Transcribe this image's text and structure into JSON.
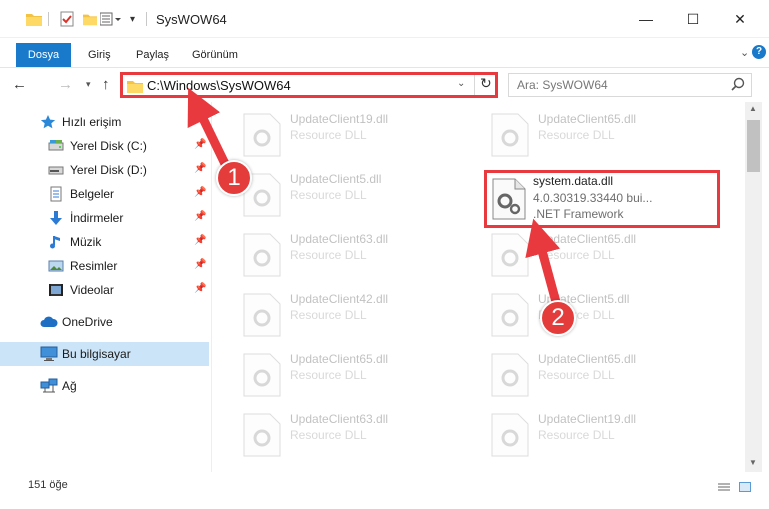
{
  "window": {
    "title": "SysWOW64",
    "minimize_glyph": "—",
    "maximize_glyph": "☐",
    "close_glyph": "✕"
  },
  "ribbon": {
    "tabs": [
      "Dosya",
      "Giriş",
      "Paylaş",
      "Görünüm"
    ]
  },
  "address_bar": {
    "path": "C:\\Windows\\SysWOW64"
  },
  "search": {
    "placeholder": "Ara: SysWOW64"
  },
  "sidebar": {
    "items": [
      {
        "label": "Hızlı erişim",
        "icon": "star-icon",
        "pinned": false
      },
      {
        "label": "Yerel Disk (C:)",
        "icon": "drive-icon",
        "pinned": true
      },
      {
        "label": "Yerel Disk (D:)",
        "icon": "drive-icon",
        "pinned": true
      },
      {
        "label": "Belgeler",
        "icon": "documents-icon",
        "pinned": true
      },
      {
        "label": "İndirmeler",
        "icon": "download-icon",
        "pinned": true
      },
      {
        "label": "Müzik",
        "icon": "music-icon",
        "pinned": true
      },
      {
        "label": "Resimler",
        "icon": "pictures-icon",
        "pinned": true
      },
      {
        "label": "Videolar",
        "icon": "videos-icon",
        "pinned": true
      },
      {
        "label": "OneDrive",
        "icon": "cloud-icon",
        "pinned": false
      },
      {
        "label": "Bu bilgisayar",
        "icon": "computer-icon",
        "pinned": false,
        "selected": true
      },
      {
        "label": "Ağ",
        "icon": "network-icon",
        "pinned": false
      }
    ]
  },
  "files": {
    "left_column": [
      {
        "name": "UpdateClient19.dll",
        "type": "Resource DLL"
      },
      {
        "name": "UpdateClient5.dll",
        "type": "Resource DLL"
      },
      {
        "name": "UpdateClient63.dll",
        "type": "Resource DLL"
      },
      {
        "name": "UpdateClient42.dll",
        "type": "Resource DLL"
      },
      {
        "name": "UpdateClient65.dll",
        "type": "Resource DLL"
      },
      {
        "name": "UpdateClient63.dll",
        "type": "Resource DLL"
      }
    ],
    "right_column": [
      {
        "name": "UpdateClient65.dll",
        "type": "Resource DLL"
      },
      {
        "name": "UpdateClient65.dll",
        "type": "Resource DLL"
      },
      {
        "name": "UpdateClient5.dll",
        "type": "Resource DLL"
      },
      {
        "name": "UpdateClient65.dll",
        "type": "Resource DLL"
      },
      {
        "name": "UpdateClient19.dll",
        "type": "Resource DLL"
      }
    ],
    "highlighted": {
      "name": "system.data.dll",
      "version": "4.0.30319.33440 bui...",
      "type": ".NET Framework"
    }
  },
  "callouts": [
    "1",
    "2"
  ],
  "status": {
    "item_count": "151 öğe"
  },
  "colors": {
    "accent": "#1979ca",
    "highlight_red": "#e8393f",
    "selected_bg": "#cce4f7"
  }
}
